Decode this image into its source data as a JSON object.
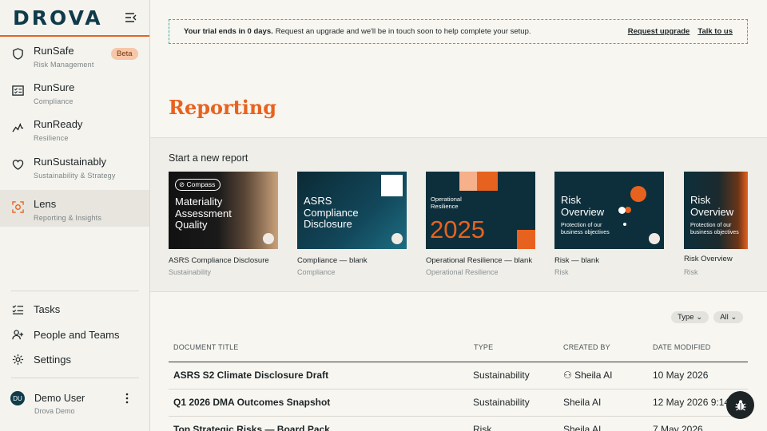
{
  "brand": {
    "logo_text": "DROVA",
    "accent": "#e8621f",
    "navy": "#0f3b4a"
  },
  "sidebar": {
    "items": [
      {
        "label": "RunSafe",
        "sub": "Risk Management",
        "icon": "shield-icon",
        "badge": "Beta"
      },
      {
        "label": "RunSure",
        "sub": "Compliance",
        "icon": "checklist-icon"
      },
      {
        "label": "RunReady",
        "sub": "Resilience",
        "icon": "chart-line-icon"
      },
      {
        "label": "RunSustainably",
        "sub": "Sustainability & Strategy",
        "icon": "heart-icon"
      },
      {
        "label": "Lens",
        "sub": "Reporting & Insights",
        "icon": "lens-icon",
        "active": true
      }
    ],
    "bottom": [
      {
        "label": "Tasks",
        "icon": "tasks-icon"
      },
      {
        "label": "People and Teams",
        "icon": "people-icon"
      },
      {
        "label": "Settings",
        "icon": "gear-icon"
      }
    ],
    "user": {
      "initials": "DU",
      "name": "Demo User",
      "org": "Drova Demo"
    }
  },
  "banner": {
    "bold": "Your trial ends in 0 days.",
    "text": "Request an upgrade and we'll be in touch soon to help complete your setup.",
    "link1": "Request upgrade",
    "link2": "Talk to us"
  },
  "page": {
    "title": "Reporting"
  },
  "new_report": {
    "title": "Start a new report",
    "cards": [
      {
        "thumb_badge": "Compass",
        "thumb_title": "Materiality Assessment Quality",
        "name": "ASRS Compliance Disclosure",
        "category": "Sustainability"
      },
      {
        "thumb_title": "ASRS Compliance Disclosure",
        "name": "Compliance — blank",
        "category": "Compliance"
      },
      {
        "thumb_title": "Operational Resilience",
        "thumb_year": "2025",
        "name": "Operational Resilience — blank",
        "category": "Operational Resilience"
      },
      {
        "thumb_title": "Risk Overview",
        "thumb_sub": "Protection of our business objectives",
        "name": "Risk — blank",
        "category": "Risk"
      },
      {
        "thumb_title": "Risk Overview",
        "thumb_sub": "Protection of our business objectives",
        "name": "Risk Overview",
        "category": "Risk"
      }
    ]
  },
  "filters": {
    "type": "Type",
    "all": "All"
  },
  "table": {
    "headers": [
      "DOCUMENT TITLE",
      "TYPE",
      "CREATED BY",
      "DATE MODIFIED"
    ],
    "rows": [
      {
        "title": "ASRS S2 Climate Disclosure Draft",
        "type": "Sustainability",
        "created_by": "Sheila AI",
        "date": "10 May 2026"
      },
      {
        "title": "Q1 2026 DMA Outcomes Snapshot",
        "type": "Sustainability",
        "created_by": "Sheila AI",
        "date": "12 May 2026 9:14"
      },
      {
        "title": "Top Strategic Risks — Board Pack",
        "type": "Risk",
        "created_by": "Sheila AI",
        "date": "7 May 2026"
      }
    ]
  }
}
